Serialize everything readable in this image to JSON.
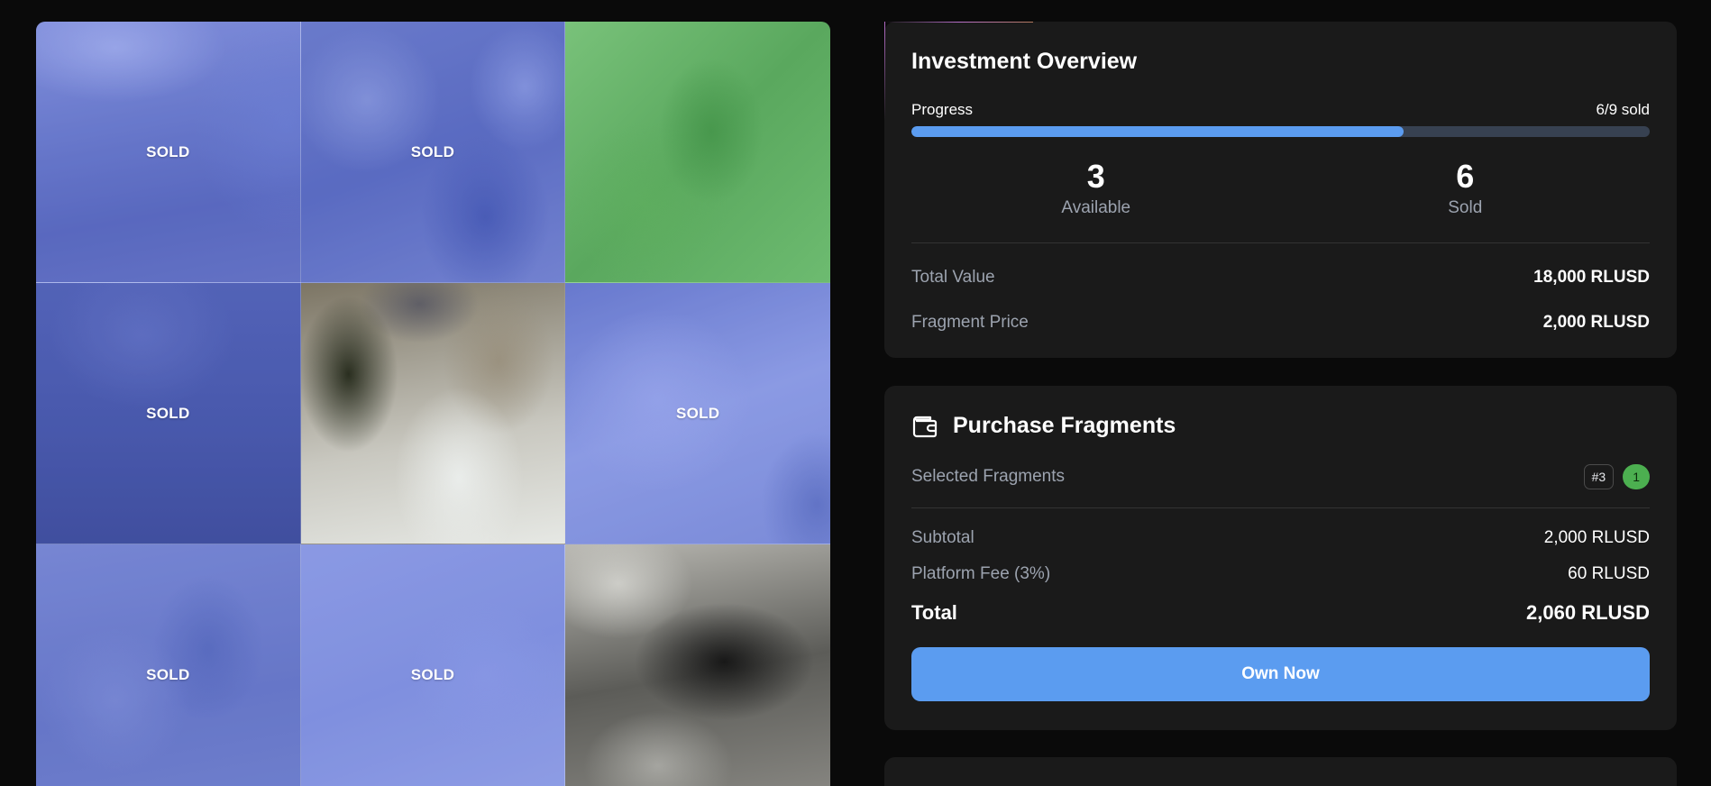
{
  "fragments": [
    {
      "label": "SOLD",
      "sold": true
    },
    {
      "label": "SOLD",
      "sold": true
    },
    {
      "label": "",
      "sold": false
    },
    {
      "label": "SOLD",
      "sold": true
    },
    {
      "label": "",
      "sold": false
    },
    {
      "label": "SOLD",
      "sold": true
    },
    {
      "label": "SOLD",
      "sold": true
    },
    {
      "label": "SOLD",
      "sold": true
    },
    {
      "label": "",
      "sold": false
    }
  ],
  "overview": {
    "title": "Investment Overview",
    "progress_label": "Progress",
    "progress_text": "6/9 sold",
    "progress_fraction": 0.6667,
    "available_count": "3",
    "available_label": "Available",
    "sold_count": "6",
    "sold_label": "Sold",
    "total_value_label": "Total Value",
    "total_value": "18,000 RLUSD",
    "fragment_price_label": "Fragment Price",
    "fragment_price": "2,000 RLUSD"
  },
  "purchase": {
    "title": "Purchase Fragments",
    "icon": "wallet-icon",
    "selected_label": "Selected Fragments",
    "selected_tag": "#3",
    "selected_count": "1",
    "subtotal_label": "Subtotal",
    "subtotal": "2,000 RLUSD",
    "fee_label": "Platform Fee (3%)",
    "fee": "60 RLUSD",
    "total_label": "Total",
    "total": "2,060 RLUSD",
    "button_label": "Own Now"
  },
  "colors": {
    "accent": "#5b9cf0",
    "panel": "#1a1a1a",
    "background": "#0a0a0a",
    "count_badge": "#4caf50",
    "muted_text": "#9ca3af"
  }
}
